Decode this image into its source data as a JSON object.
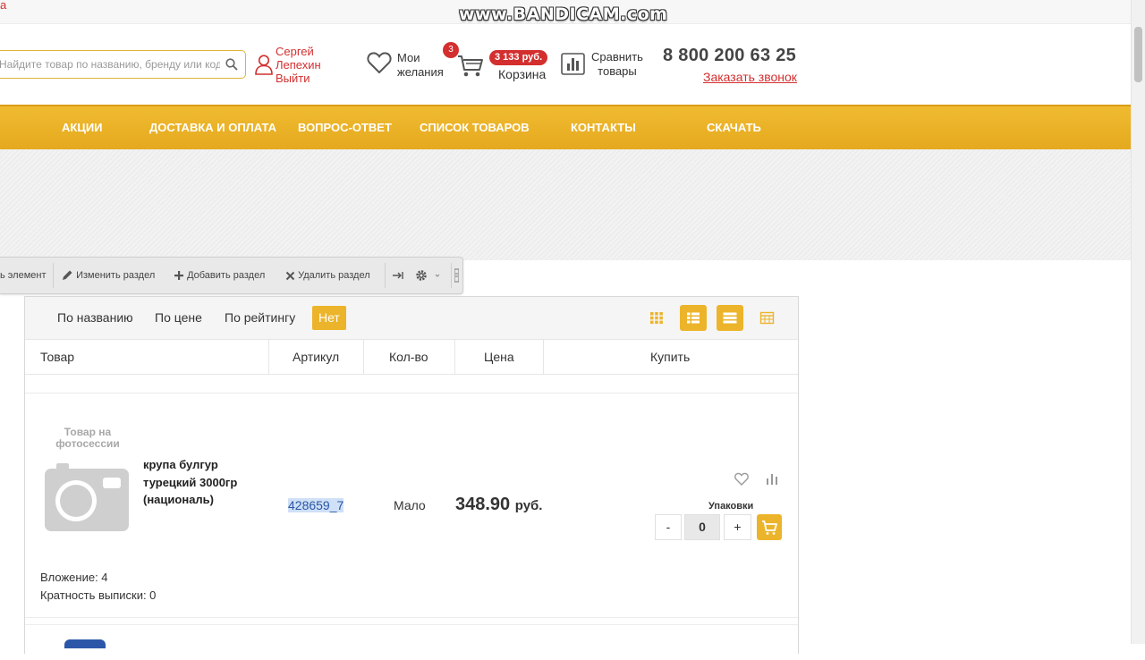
{
  "topstrip": {
    "red_fragment": "а"
  },
  "watermark": "www.BANDICAM.com",
  "header": {
    "search": {
      "placeholder": "Найдите товар по названию, бренду или коду"
    },
    "user": {
      "first_name": "Сергей",
      "last_name": "Лепехин",
      "logout": "Выйти"
    },
    "wishlist": {
      "line1": "Мои",
      "line2": "желания"
    },
    "cart": {
      "count": "3",
      "sum": "3 133 руб.",
      "label": "Корзина"
    },
    "compare": {
      "line1": "Сравнить",
      "line2": "товары"
    },
    "phone": "8 800 200 63 25",
    "callback": "Заказать звонок"
  },
  "nav": {
    "items": [
      "АКЦИИ",
      "ДОСТАВКА И ОПЛАТА",
      "ВОПРОС-ОТВЕТ",
      "СПИСОК ТОВАРОВ",
      "КОНТАКТЫ",
      "СКАЧАТЬ"
    ]
  },
  "admin_toolbar": {
    "edit_element": "ь элемент",
    "edit_section": "Изменить раздел",
    "add_section": "Добавить раздел",
    "delete_section": "Удалить раздел"
  },
  "catalog": {
    "sort": {
      "by_name": "По названию",
      "by_price": "По цене",
      "by_rating": "По рейтингу",
      "active": "Нет"
    },
    "columns": {
      "product": "Товар",
      "sku": "Артикул",
      "qty": "Кол-во",
      "price": "Цена",
      "buy": "Купить"
    },
    "product": {
      "photo_label_line1": "Товар на",
      "photo_label_line2": "фотосессии",
      "name": "крупа булгур турецкий 3000гр (националь)",
      "sku": "428659_7",
      "qty": "Мало",
      "price": "348.90",
      "currency": "руб.",
      "pack_label": "Упаковки",
      "minus": "-",
      "value": "0",
      "plus": "+",
      "nesting": "Вложение: 4",
      "multiplicity": "Кратность выписки: 0"
    }
  },
  "colors": {
    "accent": "#ecb42a",
    "nav": "#e9ae24",
    "red": "#d32f2f",
    "selection": "#cfe0f7"
  }
}
